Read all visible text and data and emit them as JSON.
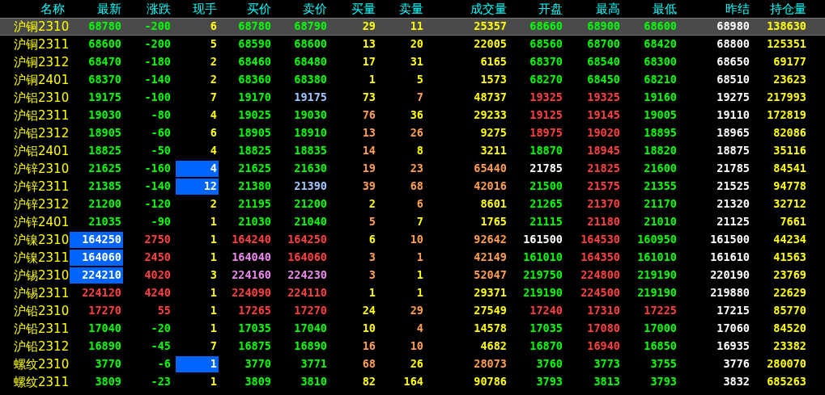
{
  "columns": [
    "名称",
    "最新",
    "涨跌",
    "现手",
    "买价",
    "卖价",
    "买量",
    "卖量",
    "成交量",
    "开盘",
    "最高",
    "最低",
    "昨结",
    "持仓量"
  ],
  "rows": [
    {
      "selected": true,
      "cells": [
        {
          "text": "沪铜2310",
          "color": "#ffff00",
          "highlighted": false
        },
        {
          "text": "68780",
          "color": "#00ff00",
          "highlighted": false
        },
        {
          "text": "-200",
          "color": "#00ff00",
          "highlighted": false
        },
        {
          "text": "6",
          "color": "#ffff00",
          "highlighted": false
        },
        {
          "text": "68780",
          "color": "#00ff00",
          "highlighted": false
        },
        {
          "text": "68790",
          "color": "#00ff00",
          "highlighted": false
        },
        {
          "text": "29",
          "color": "#ffff00",
          "highlighted": false
        },
        {
          "text": "11",
          "color": "#ffff00",
          "highlighted": false
        },
        {
          "text": "25357",
          "color": "#ffff00",
          "highlighted": false
        },
        {
          "text": "68660",
          "color": "#00ff00",
          "highlighted": false
        },
        {
          "text": "68900",
          "color": "#00ff00",
          "highlighted": false
        },
        {
          "text": "68600",
          "color": "#00ff00",
          "highlighted": false
        },
        {
          "text": "68980",
          "color": "#ffffff",
          "highlighted": false
        },
        {
          "text": "138630",
          "color": "#ffff00",
          "highlighted": false
        }
      ]
    },
    {
      "selected": false,
      "cells": [
        {
          "text": "沪铜2311",
          "color": "#ffff00",
          "highlighted": false
        },
        {
          "text": "68600",
          "color": "#00ff00",
          "highlighted": false
        },
        {
          "text": "-200",
          "color": "#00ff00",
          "highlighted": false
        },
        {
          "text": "5",
          "color": "#ffff00",
          "highlighted": false
        },
        {
          "text": "68590",
          "color": "#00ff00",
          "highlighted": false
        },
        {
          "text": "68600",
          "color": "#00ff00",
          "highlighted": false
        },
        {
          "text": "13",
          "color": "#ffff00",
          "highlighted": false
        },
        {
          "text": "20",
          "color": "#ffff00",
          "highlighted": false
        },
        {
          "text": "22005",
          "color": "#ffff00",
          "highlighted": false
        },
        {
          "text": "68560",
          "color": "#00ff00",
          "highlighted": false
        },
        {
          "text": "68700",
          "color": "#00ff00",
          "highlighted": false
        },
        {
          "text": "68420",
          "color": "#00ff00",
          "highlighted": false
        },
        {
          "text": "68800",
          "color": "#ffffff",
          "highlighted": false
        },
        {
          "text": "125351",
          "color": "#ffff00",
          "highlighted": false
        }
      ]
    },
    {
      "selected": false,
      "cells": [
        {
          "text": "沪铜2312",
          "color": "#ffff00",
          "highlighted": false
        },
        {
          "text": "68470",
          "color": "#00ff00",
          "highlighted": false
        },
        {
          "text": "-180",
          "color": "#00ff00",
          "highlighted": false
        },
        {
          "text": "2",
          "color": "#ffff00",
          "highlighted": false
        },
        {
          "text": "68460",
          "color": "#00ff00",
          "highlighted": false
        },
        {
          "text": "68480",
          "color": "#00ff00",
          "highlighted": false
        },
        {
          "text": "17",
          "color": "#ffff00",
          "highlighted": false
        },
        {
          "text": "31",
          "color": "#ffff00",
          "highlighted": false
        },
        {
          "text": "6165",
          "color": "#ffff00",
          "highlighted": false
        },
        {
          "text": "68370",
          "color": "#00ff00",
          "highlighted": false
        },
        {
          "text": "68540",
          "color": "#00ff00",
          "highlighted": false
        },
        {
          "text": "68300",
          "color": "#00ff00",
          "highlighted": false
        },
        {
          "text": "68650",
          "color": "#ffffff",
          "highlighted": false
        },
        {
          "text": "69177",
          "color": "#ffff00",
          "highlighted": false
        }
      ]
    },
    {
      "selected": false,
      "cells": [
        {
          "text": "沪铜2401",
          "color": "#ffff00",
          "highlighted": false
        },
        {
          "text": "68370",
          "color": "#00ff00",
          "highlighted": false
        },
        {
          "text": "-140",
          "color": "#00ff00",
          "highlighted": false
        },
        {
          "text": "2",
          "color": "#ffff00",
          "highlighted": false
        },
        {
          "text": "68360",
          "color": "#00ff00",
          "highlighted": false
        },
        {
          "text": "68380",
          "color": "#00ff00",
          "highlighted": false
        },
        {
          "text": "1",
          "color": "#ffff00",
          "highlighted": false
        },
        {
          "text": "5",
          "color": "#ffff00",
          "highlighted": false
        },
        {
          "text": "1573",
          "color": "#ffff00",
          "highlighted": false
        },
        {
          "text": "68270",
          "color": "#00ff00",
          "highlighted": false
        },
        {
          "text": "68450",
          "color": "#00ff00",
          "highlighted": false
        },
        {
          "text": "68210",
          "color": "#00ff00",
          "highlighted": false
        },
        {
          "text": "68510",
          "color": "#ffffff",
          "highlighted": false
        },
        {
          "text": "23623",
          "color": "#ffff00",
          "highlighted": false
        }
      ]
    },
    {
      "selected": false,
      "cells": [
        {
          "text": "沪铝2310",
          "color": "#ffff00",
          "highlighted": false
        },
        {
          "text": "19175",
          "color": "#00ff00",
          "highlighted": false
        },
        {
          "text": "-100",
          "color": "#00ff00",
          "highlighted": false
        },
        {
          "text": "7",
          "color": "#ffff00",
          "highlighted": false
        },
        {
          "text": "19170",
          "color": "#00ff00",
          "highlighted": false
        },
        {
          "text": "19175",
          "color": "#a0c8ff",
          "highlighted": false
        },
        {
          "text": "73",
          "color": "#ffff00",
          "highlighted": false
        },
        {
          "text": "7",
          "color": "#ff9f4f",
          "highlighted": false
        },
        {
          "text": "48737",
          "color": "#ffff00",
          "highlighted": false
        },
        {
          "text": "19325",
          "color": "#ff4040",
          "highlighted": false
        },
        {
          "text": "19325",
          "color": "#ff4040",
          "highlighted": false
        },
        {
          "text": "19160",
          "color": "#00ff00",
          "highlighted": false
        },
        {
          "text": "19275",
          "color": "#ffffff",
          "highlighted": false
        },
        {
          "text": "217993",
          "color": "#ffff00",
          "highlighted": false
        }
      ]
    },
    {
      "selected": false,
      "cells": [
        {
          "text": "沪铝2311",
          "color": "#ffff00",
          "highlighted": false
        },
        {
          "text": "19030",
          "color": "#00ff00",
          "highlighted": false
        },
        {
          "text": "-80",
          "color": "#00ff00",
          "highlighted": false
        },
        {
          "text": "4",
          "color": "#ffff00",
          "highlighted": false
        },
        {
          "text": "19025",
          "color": "#00ff00",
          "highlighted": false
        },
        {
          "text": "19030",
          "color": "#00ff00",
          "highlighted": false
        },
        {
          "text": "76",
          "color": "#ff9f4f",
          "highlighted": false
        },
        {
          "text": "36",
          "color": "#ffff00",
          "highlighted": false
        },
        {
          "text": "29233",
          "color": "#ffff00",
          "highlighted": false
        },
        {
          "text": "19125",
          "color": "#ff4040",
          "highlighted": false
        },
        {
          "text": "19145",
          "color": "#ff4040",
          "highlighted": false
        },
        {
          "text": "19005",
          "color": "#00ff00",
          "highlighted": false
        },
        {
          "text": "19110",
          "color": "#ffffff",
          "highlighted": false
        },
        {
          "text": "172819",
          "color": "#ffff00",
          "highlighted": false
        }
      ]
    },
    {
      "selected": false,
      "cells": [
        {
          "text": "沪铝2312",
          "color": "#ffff00",
          "highlighted": false
        },
        {
          "text": "18905",
          "color": "#00ff00",
          "highlighted": false
        },
        {
          "text": "-60",
          "color": "#00ff00",
          "highlighted": false
        },
        {
          "text": "6",
          "color": "#ffff00",
          "highlighted": false
        },
        {
          "text": "18905",
          "color": "#00ff00",
          "highlighted": false
        },
        {
          "text": "18910",
          "color": "#00ff00",
          "highlighted": false
        },
        {
          "text": "13",
          "color": "#ff9f4f",
          "highlighted": false
        },
        {
          "text": "26",
          "color": "#ff9f4f",
          "highlighted": false
        },
        {
          "text": "9275",
          "color": "#ffff00",
          "highlighted": false
        },
        {
          "text": "18975",
          "color": "#ff4040",
          "highlighted": false
        },
        {
          "text": "19020",
          "color": "#ff4040",
          "highlighted": false
        },
        {
          "text": "18895",
          "color": "#00ff00",
          "highlighted": false
        },
        {
          "text": "18965",
          "color": "#ffffff",
          "highlighted": false
        },
        {
          "text": "82086",
          "color": "#ffff00",
          "highlighted": false
        }
      ]
    },
    {
      "selected": false,
      "cells": [
        {
          "text": "沪铝2401",
          "color": "#ffff00",
          "highlighted": false
        },
        {
          "text": "18825",
          "color": "#00ff00",
          "highlighted": false
        },
        {
          "text": "-50",
          "color": "#00ff00",
          "highlighted": false
        },
        {
          "text": "4",
          "color": "#ffff00",
          "highlighted": false
        },
        {
          "text": "18825",
          "color": "#00ff00",
          "highlighted": false
        },
        {
          "text": "18835",
          "color": "#00ff00",
          "highlighted": false
        },
        {
          "text": "14",
          "color": "#ff9f4f",
          "highlighted": false
        },
        {
          "text": "8",
          "color": "#ffff00",
          "highlighted": false
        },
        {
          "text": "3211",
          "color": "#ffff00",
          "highlighted": false
        },
        {
          "text": "18870",
          "color": "#00ff00",
          "highlighted": false
        },
        {
          "text": "18945",
          "color": "#ff4040",
          "highlighted": false
        },
        {
          "text": "18820",
          "color": "#00ff00",
          "highlighted": false
        },
        {
          "text": "18875",
          "color": "#ffffff",
          "highlighted": false
        },
        {
          "text": "35116",
          "color": "#ffff00",
          "highlighted": false
        }
      ]
    },
    {
      "selected": false,
      "cells": [
        {
          "text": "沪锌2310",
          "color": "#ffff00",
          "highlighted": false
        },
        {
          "text": "21625",
          "color": "#00ff00",
          "highlighted": false
        },
        {
          "text": "-160",
          "color": "#00ff00",
          "highlighted": false
        },
        {
          "text": "4",
          "color": "#ffffff",
          "highlighted": true
        },
        {
          "text": "21625",
          "color": "#00ff00",
          "highlighted": false
        },
        {
          "text": "21630",
          "color": "#00ff00",
          "highlighted": false
        },
        {
          "text": "19",
          "color": "#ff9f4f",
          "highlighted": false
        },
        {
          "text": "23",
          "color": "#ff9f4f",
          "highlighted": false
        },
        {
          "text": "65440",
          "color": "#ff9f4f",
          "highlighted": false
        },
        {
          "text": "21785",
          "color": "#ffffff",
          "highlighted": false
        },
        {
          "text": "21825",
          "color": "#ff4040",
          "highlighted": false
        },
        {
          "text": "21600",
          "color": "#00ff00",
          "highlighted": false
        },
        {
          "text": "21785",
          "color": "#ffffff",
          "highlighted": false
        },
        {
          "text": "84541",
          "color": "#ffff00",
          "highlighted": false
        }
      ]
    },
    {
      "selected": false,
      "cells": [
        {
          "text": "沪锌2311",
          "color": "#ffff00",
          "highlighted": false
        },
        {
          "text": "21385",
          "color": "#00ff00",
          "highlighted": false
        },
        {
          "text": "-140",
          "color": "#00ff00",
          "highlighted": false
        },
        {
          "text": "12",
          "color": "#ffffff",
          "highlighted": true
        },
        {
          "text": "21380",
          "color": "#00ff00",
          "highlighted": false
        },
        {
          "text": "21390",
          "color": "#a0c8ff",
          "highlighted": false
        },
        {
          "text": "39",
          "color": "#ff9f4f",
          "highlighted": false
        },
        {
          "text": "68",
          "color": "#ff9f4f",
          "highlighted": false
        },
        {
          "text": "42016",
          "color": "#ff9f4f",
          "highlighted": false
        },
        {
          "text": "21500",
          "color": "#00ff00",
          "highlighted": false
        },
        {
          "text": "21575",
          "color": "#ff4040",
          "highlighted": false
        },
        {
          "text": "21355",
          "color": "#00ff00",
          "highlighted": false
        },
        {
          "text": "21525",
          "color": "#ffffff",
          "highlighted": false
        },
        {
          "text": "94778",
          "color": "#ffff00",
          "highlighted": false
        }
      ]
    },
    {
      "selected": false,
      "cells": [
        {
          "text": "沪锌2312",
          "color": "#ffff00",
          "highlighted": false
        },
        {
          "text": "21200",
          "color": "#00ff00",
          "highlighted": false
        },
        {
          "text": "-120",
          "color": "#00ff00",
          "highlighted": false
        },
        {
          "text": "2",
          "color": "#ffff00",
          "highlighted": false
        },
        {
          "text": "21195",
          "color": "#00ff00",
          "highlighted": false
        },
        {
          "text": "21200",
          "color": "#00ff00",
          "highlighted": false
        },
        {
          "text": "2",
          "color": "#ffff00",
          "highlighted": false
        },
        {
          "text": "6",
          "color": "#ff9f4f",
          "highlighted": false
        },
        {
          "text": "8601",
          "color": "#ffff00",
          "highlighted": false
        },
        {
          "text": "21265",
          "color": "#00ff00",
          "highlighted": false
        },
        {
          "text": "21370",
          "color": "#ff4040",
          "highlighted": false
        },
        {
          "text": "21170",
          "color": "#00ff00",
          "highlighted": false
        },
        {
          "text": "21320",
          "color": "#ffffff",
          "highlighted": false
        },
        {
          "text": "32712",
          "color": "#ffff00",
          "highlighted": false
        }
      ]
    },
    {
      "selected": false,
      "cells": [
        {
          "text": "沪锌2401",
          "color": "#ffff00",
          "highlighted": false
        },
        {
          "text": "21035",
          "color": "#00ff00",
          "highlighted": false
        },
        {
          "text": "-90",
          "color": "#00ff00",
          "highlighted": false
        },
        {
          "text": "1",
          "color": "#ffff00",
          "highlighted": false
        },
        {
          "text": "21030",
          "color": "#00ff00",
          "highlighted": false
        },
        {
          "text": "21040",
          "color": "#00ff00",
          "highlighted": false
        },
        {
          "text": "5",
          "color": "#ff9f4f",
          "highlighted": false
        },
        {
          "text": "7",
          "color": "#ffff00",
          "highlighted": false
        },
        {
          "text": "1765",
          "color": "#ffff00",
          "highlighted": false
        },
        {
          "text": "21115",
          "color": "#00ff00",
          "highlighted": false
        },
        {
          "text": "21180",
          "color": "#ff4040",
          "highlighted": false
        },
        {
          "text": "21010",
          "color": "#00ff00",
          "highlighted": false
        },
        {
          "text": "21125",
          "color": "#ffffff",
          "highlighted": false
        },
        {
          "text": "7661",
          "color": "#ffff00",
          "highlighted": false
        }
      ]
    },
    {
      "selected": false,
      "cells": [
        {
          "text": "沪镍2310",
          "color": "#ffff00",
          "highlighted": false
        },
        {
          "text": "164250",
          "color": "#ffffff",
          "highlighted": true
        },
        {
          "text": "2750",
          "color": "#ff4040",
          "highlighted": false
        },
        {
          "text": "1",
          "color": "#ffff00",
          "highlighted": false
        },
        {
          "text": "164240",
          "color": "#ff4040",
          "highlighted": false
        },
        {
          "text": "164250",
          "color": "#ff4040",
          "highlighted": false
        },
        {
          "text": "6",
          "color": "#ffff00",
          "highlighted": false
        },
        {
          "text": "10",
          "color": "#ff9f4f",
          "highlighted": false
        },
        {
          "text": "92642",
          "color": "#ff9f4f",
          "highlighted": false
        },
        {
          "text": "161500",
          "color": "#ffffff",
          "highlighted": false
        },
        {
          "text": "164530",
          "color": "#ff4040",
          "highlighted": false
        },
        {
          "text": "160950",
          "color": "#00ff00",
          "highlighted": false
        },
        {
          "text": "161500",
          "color": "#ffffff",
          "highlighted": false
        },
        {
          "text": "44234",
          "color": "#ffff00",
          "highlighted": false
        }
      ]
    },
    {
      "selected": false,
      "cells": [
        {
          "text": "沪镍2311",
          "color": "#ffff00",
          "highlighted": false
        },
        {
          "text": "164060",
          "color": "#ffffff",
          "highlighted": true
        },
        {
          "text": "2450",
          "color": "#ff4040",
          "highlighted": false
        },
        {
          "text": "1",
          "color": "#ffff00",
          "highlighted": false
        },
        {
          "text": "164040",
          "color": "#ee88ee",
          "highlighted": false
        },
        {
          "text": "164060",
          "color": "#ff4040",
          "highlighted": false
        },
        {
          "text": "3",
          "color": "#ff9f4f",
          "highlighted": false
        },
        {
          "text": "1",
          "color": "#ff9f4f",
          "highlighted": false
        },
        {
          "text": "42149",
          "color": "#ff9f4f",
          "highlighted": false
        },
        {
          "text": "161010",
          "color": "#00ff00",
          "highlighted": false
        },
        {
          "text": "164350",
          "color": "#ff4040",
          "highlighted": false
        },
        {
          "text": "161010",
          "color": "#00ff00",
          "highlighted": false
        },
        {
          "text": "161610",
          "color": "#ffffff",
          "highlighted": false
        },
        {
          "text": "41563",
          "color": "#ffff00",
          "highlighted": false
        }
      ]
    },
    {
      "selected": false,
      "cells": [
        {
          "text": "沪锡2310",
          "color": "#ffff00",
          "highlighted": false
        },
        {
          "text": "224210",
          "color": "#ffffff",
          "highlighted": true
        },
        {
          "text": "4020",
          "color": "#ff4040",
          "highlighted": false
        },
        {
          "text": "3",
          "color": "#ffff00",
          "highlighted": false
        },
        {
          "text": "224160",
          "color": "#ee88ee",
          "highlighted": false
        },
        {
          "text": "224230",
          "color": "#ee88ee",
          "highlighted": false
        },
        {
          "text": "3",
          "color": "#ff9f4f",
          "highlighted": false
        },
        {
          "text": "1",
          "color": "#ffff00",
          "highlighted": false
        },
        {
          "text": "52047",
          "color": "#ff9f4f",
          "highlighted": false
        },
        {
          "text": "219750",
          "color": "#00ff00",
          "highlighted": false
        },
        {
          "text": "224800",
          "color": "#ff4040",
          "highlighted": false
        },
        {
          "text": "219190",
          "color": "#00ff00",
          "highlighted": false
        },
        {
          "text": "220190",
          "color": "#ffffff",
          "highlighted": false
        },
        {
          "text": "23769",
          "color": "#ffff00",
          "highlighted": false
        }
      ]
    },
    {
      "selected": false,
      "cells": [
        {
          "text": "沪锡2311",
          "color": "#ffff00",
          "highlighted": false
        },
        {
          "text": "224120",
          "color": "#ff4040",
          "highlighted": false
        },
        {
          "text": "4240",
          "color": "#ff4040",
          "highlighted": false
        },
        {
          "text": "1",
          "color": "#ffff00",
          "highlighted": false
        },
        {
          "text": "224090",
          "color": "#ff4040",
          "highlighted": false
        },
        {
          "text": "224110",
          "color": "#ff4040",
          "highlighted": false
        },
        {
          "text": "1",
          "color": "#ffff00",
          "highlighted": false
        },
        {
          "text": "1",
          "color": "#ffff00",
          "highlighted": false
        },
        {
          "text": "29371",
          "color": "#ffff00",
          "highlighted": false
        },
        {
          "text": "219190",
          "color": "#00ff00",
          "highlighted": false
        },
        {
          "text": "224500",
          "color": "#ff4040",
          "highlighted": false
        },
        {
          "text": "219190",
          "color": "#00ff00",
          "highlighted": false
        },
        {
          "text": "219880",
          "color": "#ffffff",
          "highlighted": false
        },
        {
          "text": "22629",
          "color": "#ffff00",
          "highlighted": false
        }
      ]
    },
    {
      "selected": false,
      "cells": [
        {
          "text": "沪铅2310",
          "color": "#ffff00",
          "highlighted": false
        },
        {
          "text": "17270",
          "color": "#ff4040",
          "highlighted": false
        },
        {
          "text": "55",
          "color": "#ff4040",
          "highlighted": false
        },
        {
          "text": "1",
          "color": "#ffff00",
          "highlighted": false
        },
        {
          "text": "17265",
          "color": "#ff4040",
          "highlighted": false
        },
        {
          "text": "17270",
          "color": "#ff4040",
          "highlighted": false
        },
        {
          "text": "24",
          "color": "#ffff00",
          "highlighted": false
        },
        {
          "text": "29",
          "color": "#ff9f4f",
          "highlighted": false
        },
        {
          "text": "27549",
          "color": "#ffff00",
          "highlighted": false
        },
        {
          "text": "17240",
          "color": "#ff4040",
          "highlighted": false
        },
        {
          "text": "17310",
          "color": "#ff4040",
          "highlighted": false
        },
        {
          "text": "17225",
          "color": "#ff4040",
          "highlighted": false
        },
        {
          "text": "17215",
          "color": "#ffffff",
          "highlighted": false
        },
        {
          "text": "85770",
          "color": "#ffff00",
          "highlighted": false
        }
      ]
    },
    {
      "selected": false,
      "cells": [
        {
          "text": "沪铅2311",
          "color": "#ffff00",
          "highlighted": false
        },
        {
          "text": "17040",
          "color": "#00ff00",
          "highlighted": false
        },
        {
          "text": "-20",
          "color": "#00ff00",
          "highlighted": false
        },
        {
          "text": "1",
          "color": "#ffff00",
          "highlighted": false
        },
        {
          "text": "17035",
          "color": "#00ff00",
          "highlighted": false
        },
        {
          "text": "17040",
          "color": "#00ff00",
          "highlighted": false
        },
        {
          "text": "10",
          "color": "#ffff00",
          "highlighted": false
        },
        {
          "text": "4",
          "color": "#ff9f4f",
          "highlighted": false
        },
        {
          "text": "14578",
          "color": "#ffff00",
          "highlighted": false
        },
        {
          "text": "17035",
          "color": "#00ff00",
          "highlighted": false
        },
        {
          "text": "17080",
          "color": "#ff4040",
          "highlighted": false
        },
        {
          "text": "17000",
          "color": "#00ff00",
          "highlighted": false
        },
        {
          "text": "17060",
          "color": "#ffffff",
          "highlighted": false
        },
        {
          "text": "84520",
          "color": "#ffff00",
          "highlighted": false
        }
      ]
    },
    {
      "selected": false,
      "cells": [
        {
          "text": "沪铅2312",
          "color": "#ffff00",
          "highlighted": false
        },
        {
          "text": "16890",
          "color": "#00ff00",
          "highlighted": false
        },
        {
          "text": "-45",
          "color": "#00ff00",
          "highlighted": false
        },
        {
          "text": "7",
          "color": "#ffff00",
          "highlighted": false
        },
        {
          "text": "16875",
          "color": "#00ff00",
          "highlighted": false
        },
        {
          "text": "16890",
          "color": "#00ff00",
          "highlighted": false
        },
        {
          "text": "16",
          "color": "#ff9f4f",
          "highlighted": false
        },
        {
          "text": "10",
          "color": "#ff9f4f",
          "highlighted": false
        },
        {
          "text": "4682",
          "color": "#ffff00",
          "highlighted": false
        },
        {
          "text": "16870",
          "color": "#00ff00",
          "highlighted": false
        },
        {
          "text": "16940",
          "color": "#ff4040",
          "highlighted": false
        },
        {
          "text": "16850",
          "color": "#00ff00",
          "highlighted": false
        },
        {
          "text": "16935",
          "color": "#ffffff",
          "highlighted": false
        },
        {
          "text": "23382",
          "color": "#ffff00",
          "highlighted": false
        }
      ]
    },
    {
      "selected": false,
      "cells": [
        {
          "text": "螺纹2310",
          "color": "#ffff00",
          "highlighted": false
        },
        {
          "text": "3770",
          "color": "#00ff00",
          "highlighted": false
        },
        {
          "text": "-6",
          "color": "#00ff00",
          "highlighted": false
        },
        {
          "text": "1",
          "color": "#ffffff",
          "highlighted": true
        },
        {
          "text": "3770",
          "color": "#00ff00",
          "highlighted": false
        },
        {
          "text": "3771",
          "color": "#00ff00",
          "highlighted": false
        },
        {
          "text": "68",
          "color": "#ff9f4f",
          "highlighted": false
        },
        {
          "text": "26",
          "color": "#ffff00",
          "highlighted": false
        },
        {
          "text": "28073",
          "color": "#ff9f4f",
          "highlighted": false
        },
        {
          "text": "3760",
          "color": "#00ff00",
          "highlighted": false
        },
        {
          "text": "3773",
          "color": "#00ff00",
          "highlighted": false
        },
        {
          "text": "3755",
          "color": "#00ff00",
          "highlighted": false
        },
        {
          "text": "3776",
          "color": "#ffffff",
          "highlighted": false
        },
        {
          "text": "280070",
          "color": "#ffff00",
          "highlighted": false
        }
      ]
    },
    {
      "selected": false,
      "cells": [
        {
          "text": "螺纹2311",
          "color": "#ffff00",
          "highlighted": false
        },
        {
          "text": "3809",
          "color": "#00ff00",
          "highlighted": false
        },
        {
          "text": "-23",
          "color": "#00ff00",
          "highlighted": false
        },
        {
          "text": "1",
          "color": "#ffff00",
          "highlighted": false
        },
        {
          "text": "3809",
          "color": "#00ff00",
          "highlighted": false
        },
        {
          "text": "3810",
          "color": "#00ff00",
          "highlighted": false
        },
        {
          "text": "82",
          "color": "#ffff00",
          "highlighted": false
        },
        {
          "text": "164",
          "color": "#ffff00",
          "highlighted": false
        },
        {
          "text": "90786",
          "color": "#ffff00",
          "highlighted": false
        },
        {
          "text": "3793",
          "color": "#00ff00",
          "highlighted": false
        },
        {
          "text": "3813",
          "color": "#00ff00",
          "highlighted": false
        },
        {
          "text": "3793",
          "color": "#00ff00",
          "highlighted": false
        },
        {
          "text": "3832",
          "color": "#ffffff",
          "highlighted": false
        },
        {
          "text": "685263",
          "color": "#ffff00",
          "highlighted": false
        }
      ]
    }
  ]
}
